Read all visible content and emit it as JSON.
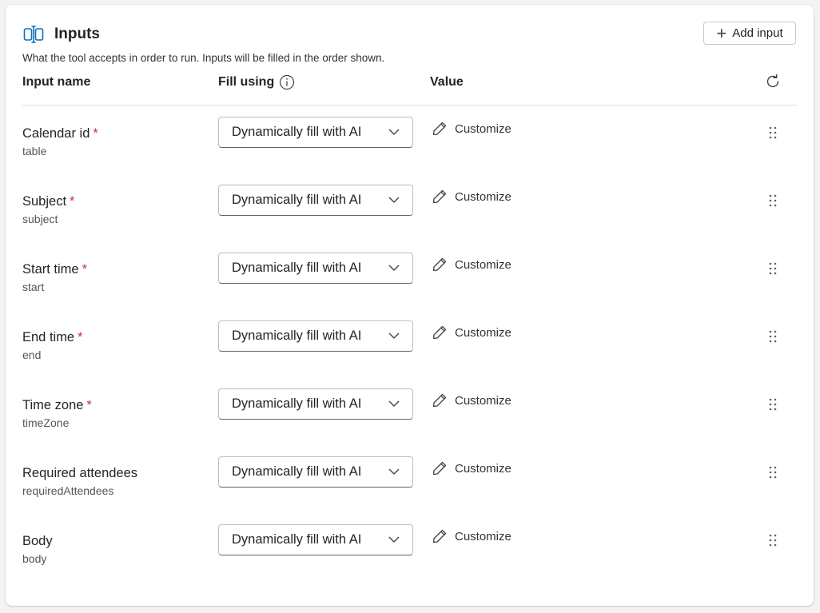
{
  "header": {
    "title": "Inputs",
    "add_button_label": "Add input",
    "description": "What the tool accepts in order to run. Inputs will be filled in the order shown."
  },
  "columns": {
    "input_name": "Input name",
    "fill_using": "Fill using",
    "value": "Value"
  },
  "rows": [
    {
      "label": "Calendar id",
      "required": "*",
      "sub": "table",
      "fill": "Dynamically fill with AI",
      "action": "Customize"
    },
    {
      "label": "Subject",
      "required": "*",
      "sub": "subject",
      "fill": "Dynamically fill with AI",
      "action": "Customize"
    },
    {
      "label": "Start time",
      "required": "*",
      "sub": "start",
      "fill": "Dynamically fill with AI",
      "action": "Customize"
    },
    {
      "label": "End time",
      "required": "*",
      "sub": "end",
      "fill": "Dynamically fill with AI",
      "action": "Customize"
    },
    {
      "label": "Time zone",
      "required": "*",
      "sub": "timeZone",
      "fill": "Dynamically fill with AI",
      "action": "Customize"
    },
    {
      "label": "Required attendees",
      "required": "",
      "sub": "requiredAttendees",
      "fill": "Dynamically fill with AI",
      "action": "Customize"
    },
    {
      "label": "Body",
      "required": "",
      "sub": "body",
      "fill": "Dynamically fill with AI",
      "action": "Customize"
    }
  ],
  "icons": {
    "header": "inputs-icon",
    "add": "plus-icon",
    "info": "info-icon",
    "refresh": "refresh-icon",
    "customize": "pencil-icon",
    "dropdown": "chevron-down-icon",
    "drag": "drag-handle-icon"
  },
  "colors": {
    "accent": "#0f6cbd",
    "required": "#c4314b"
  }
}
